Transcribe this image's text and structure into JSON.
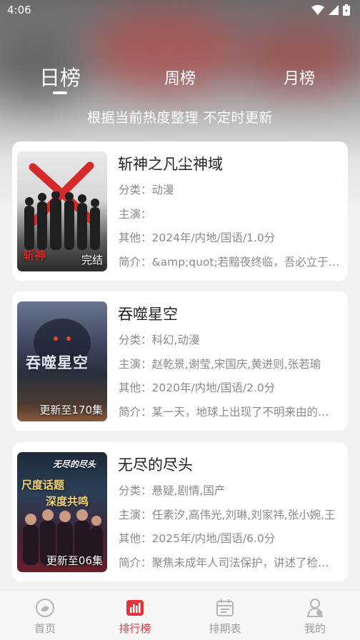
{
  "status_bar": {
    "time": "4:06"
  },
  "tabs": {
    "day": "日榜",
    "week": "周榜",
    "month": "月榜",
    "active": "day"
  },
  "subtitle": "根据当前热度整理 不定时更新",
  "labels": {
    "category": "分类：",
    "cast": "主演：",
    "other": "其他：",
    "intro": "简介："
  },
  "items": [
    {
      "title": "斩神之凡尘神域",
      "category": "动漫",
      "cast": "",
      "other": "2024年/内地/国语/1.0分",
      "intro": "&amp;quot;若黯夜终临，吾必立于万万人前...",
      "badge": "完结",
      "poster_text": "斩神"
    },
    {
      "title": "吞噬星空",
      "category": "科幻,动漫",
      "cast": "赵乾景,谢莹,宋国庆,黄进则,张若瑜",
      "other": "2020年/内地/国语/2.0分",
      "intro": "某一天，地球上出现了不明来由的病毒",
      "badge": "更新至170集",
      "poster_text": "吞噬星空"
    },
    {
      "title": "无尽的尽头",
      "category": "悬疑,剧情,国产",
      "cast": "任素汐,高伟光,刘琳,刘家祎,张小婉,王",
      "other": "2025年/内地/国语/6.0分",
      "intro": "聚焦未成年人司法保护，讲述了检察官",
      "badge": "更新至06集",
      "poster_text_1": "尺度话题",
      "poster_text_2": "深度共鸣",
      "poster_sign": "无尽的尽头"
    }
  ],
  "nav": [
    {
      "label": "首页",
      "icon": "home-icon"
    },
    {
      "label": "排行榜",
      "icon": "chart-icon",
      "active": true
    },
    {
      "label": "排期表",
      "icon": "calendar-icon"
    },
    {
      "label": "我的",
      "icon": "profile-icon"
    }
  ],
  "colors": {
    "accent": "#e2343a",
    "muted": "#9a9a9a",
    "card": "#ffffff"
  }
}
